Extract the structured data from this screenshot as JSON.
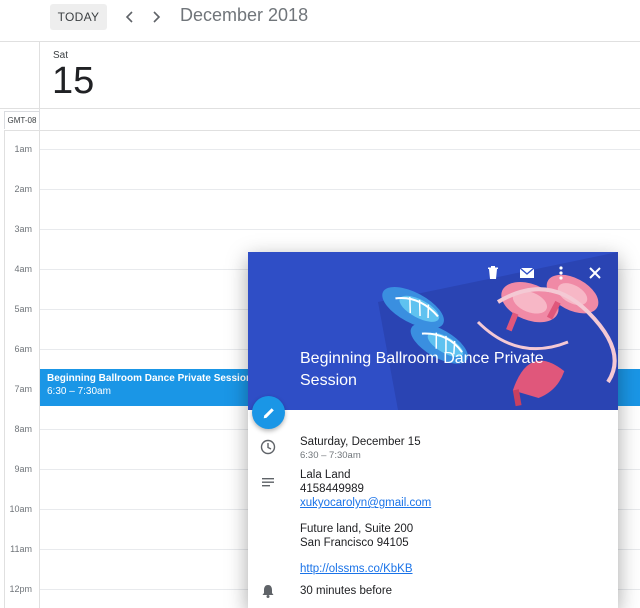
{
  "toolbar": {
    "today_label": "TODAY",
    "prev_icon": "chevron-left-icon",
    "next_icon": "chevron-right-icon",
    "month_title": "December 2018"
  },
  "day": {
    "weekday": "Sat",
    "date": "15",
    "timezone": "GMT-08"
  },
  "hours": [
    "1am",
    "2am",
    "3am",
    "4am",
    "5am",
    "6am",
    "7am",
    "8am",
    "9am",
    "10am",
    "11am",
    "12pm"
  ],
  "event": {
    "title": "Beginning Ballroom Dance Private Session",
    "time": "6:30 – 7:30am",
    "color": "#1a96e6"
  },
  "popup": {
    "title": "Beginning Ballroom Dance Private Session",
    "hero_color": "#2f4ec6",
    "actions": [
      "trash-icon",
      "email-icon",
      "more-vert-icon",
      "close-icon"
    ],
    "date_line": "Saturday, December 15",
    "time_line": "6:30 – 7:30am",
    "contact_name": "Lala Land",
    "contact_phone": "4158449989",
    "contact_email": "xukyocarolyn@gmail.com",
    "address_line1": "Future land, Suite 200",
    "address_line2": "San Francisco 94105",
    "link": "http://olssms.co/KbKB",
    "reminder": "30 minutes before"
  }
}
